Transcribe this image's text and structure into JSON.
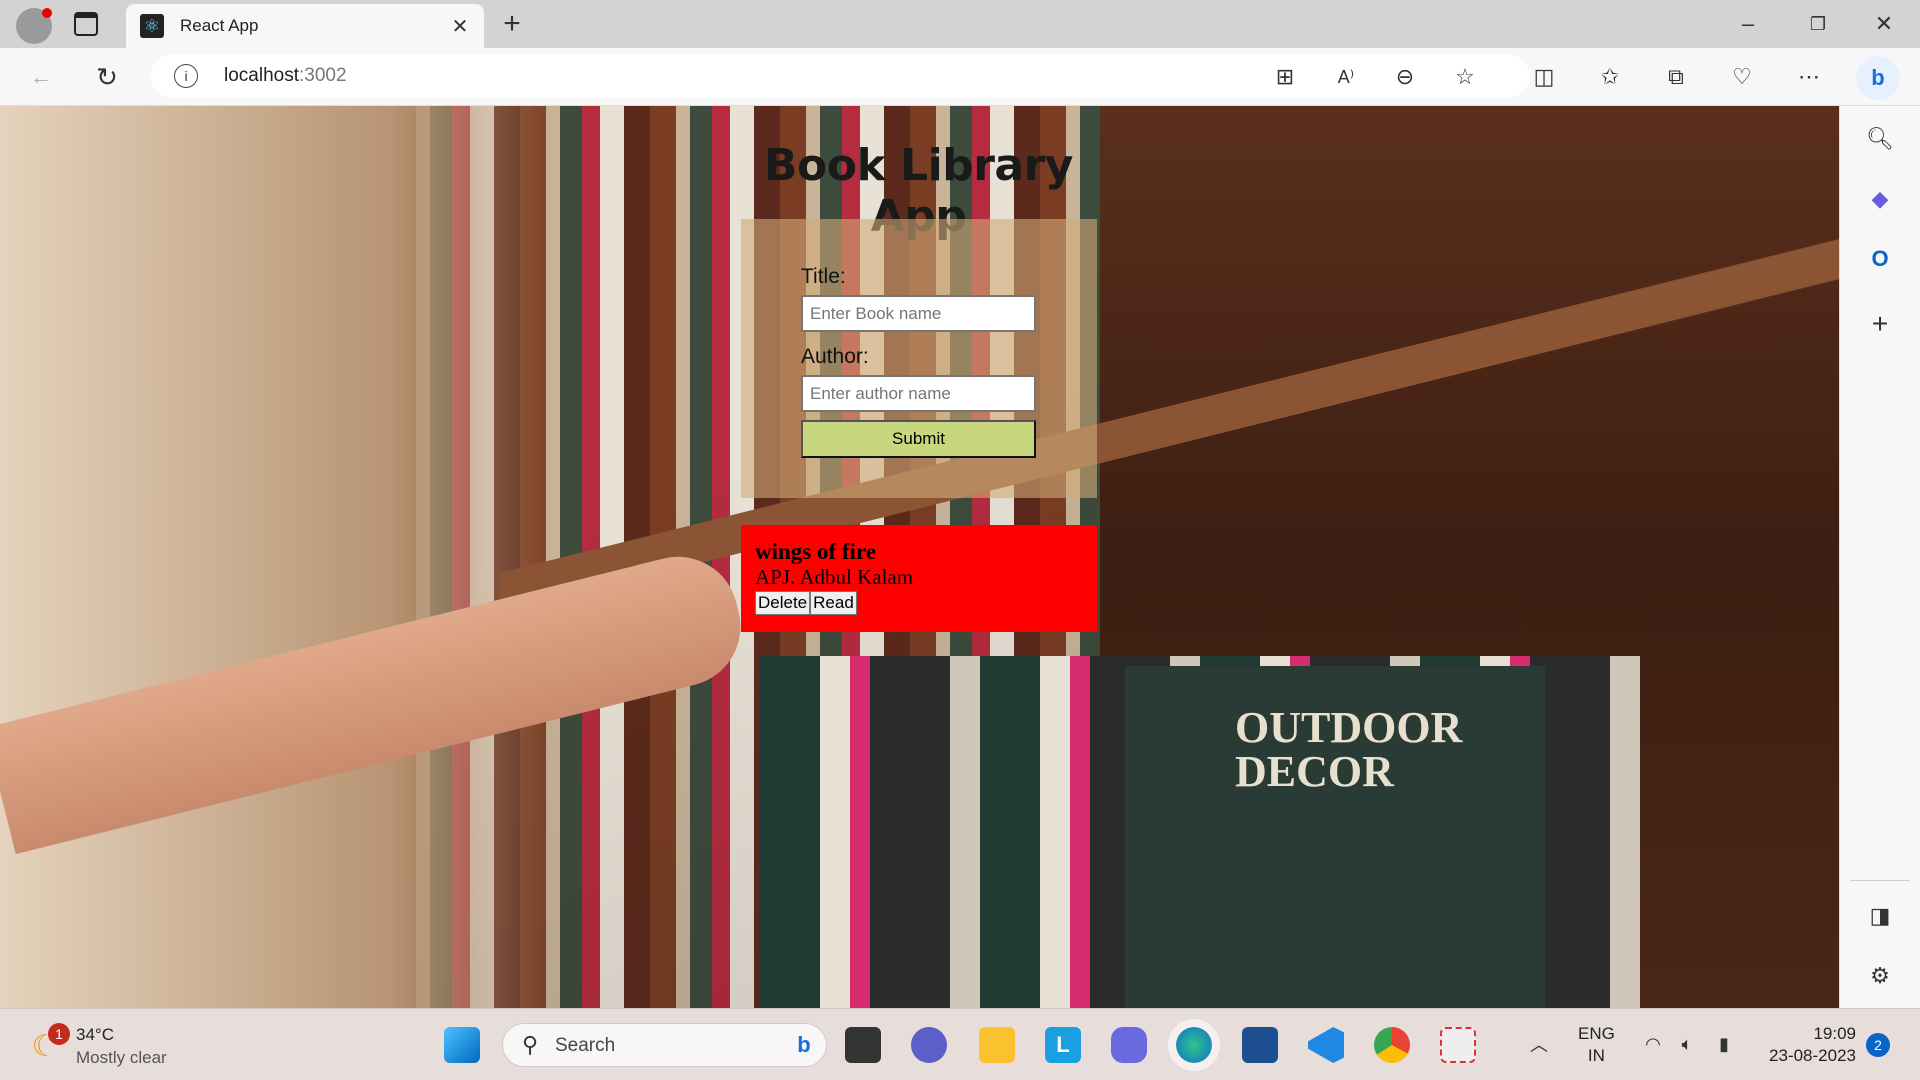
{
  "browser": {
    "tab_title": "React App",
    "url_host": "localhost",
    "url_port": ":3002"
  },
  "app": {
    "title": "Book Library App",
    "form": {
      "title_label": "Title:",
      "title_placeholder": "Enter Book name",
      "author_label": "Author:",
      "author_placeholder": "Enter author name",
      "submit_label": "Submit"
    },
    "books": [
      {
        "title": "wings of fire",
        "author": "APJ. Adbul Kalam",
        "delete_label": "Delete",
        "read_label": "Read"
      }
    ],
    "card_color": "#ff0000",
    "submit_color": "#c8d67e"
  },
  "background_sign": "OUTDOOR DECOR",
  "taskbar": {
    "weather_temp": "34°C",
    "weather_desc": "Mostly clear",
    "weather_badge": "1",
    "search_label": "Search",
    "lang_top": "ENG",
    "lang_bottom": "IN",
    "time": "19:09",
    "date": "23-08-2023",
    "notif_count": "2"
  }
}
